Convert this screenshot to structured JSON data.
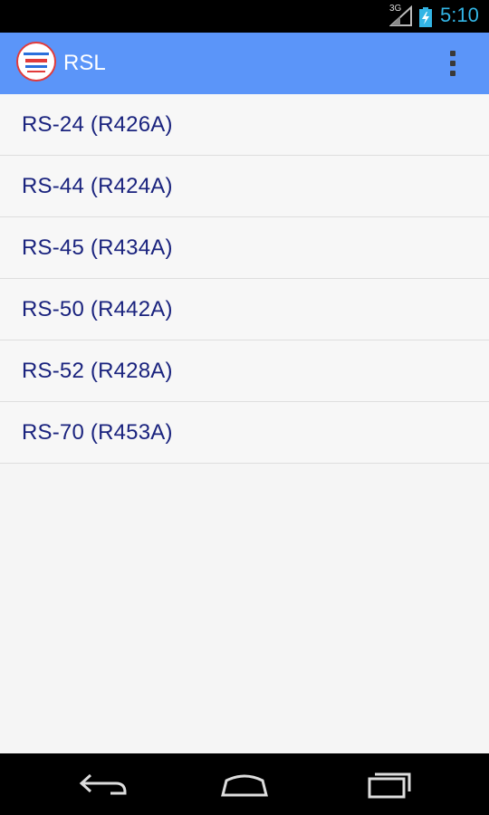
{
  "status_bar": {
    "network": "3G",
    "time": "5:10",
    "signal_icon": "signal-icon",
    "battery_icon": "battery-charging-icon"
  },
  "action_bar": {
    "title": "RSL",
    "logo_icon": "app-logo-icon",
    "menu_icon": "overflow-menu-icon",
    "color": "#5b95f9"
  },
  "list": {
    "items": [
      {
        "label": "RS-24 (R426A)"
      },
      {
        "label": "RS-44 (R424A)"
      },
      {
        "label": "RS-45 (R434A)"
      },
      {
        "label": "RS-50 (R442A)"
      },
      {
        "label": "RS-52 (R428A)"
      },
      {
        "label": "RS-70 (R453A)"
      }
    ],
    "text_color": "#1a237e"
  },
  "nav_bar": {
    "back_icon": "back-icon",
    "home_icon": "home-icon",
    "recents_icon": "recent-apps-icon"
  }
}
